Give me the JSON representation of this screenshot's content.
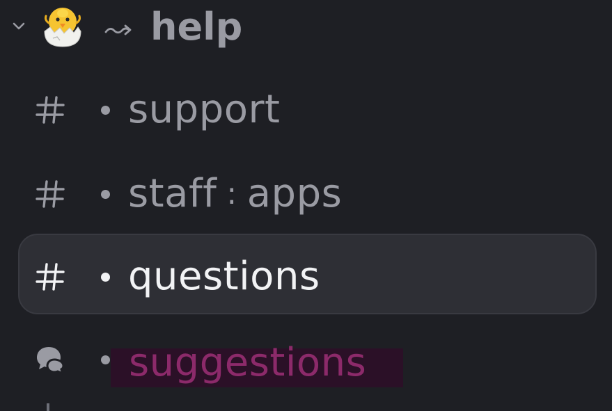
{
  "category": {
    "name": "help",
    "emoji_icon": "hatching-chick-icon",
    "arrow_icon": "squiggle-arrow-icon",
    "collapse_icon": "chevron-down-icon"
  },
  "channels": [
    {
      "icon": "hash-icon",
      "name": "support",
      "selected": false
    },
    {
      "icon": "hash-icon",
      "name": "staff",
      "separator": ":",
      "suffix": "apps",
      "selected": false
    },
    {
      "icon": "hash-icon",
      "name": "questions",
      "selected": true
    },
    {
      "icon": "forum-icon",
      "name": "suggestions",
      "selected": false,
      "highlighted": true
    }
  ],
  "colors": {
    "background": "#1e1f24",
    "muted_text": "#9a9ba3",
    "active_text": "#f2f3f5",
    "selected_row": "#2e2f35",
    "highlight_bg": "#2b1027",
    "highlight_text": "#8c2a6a"
  }
}
